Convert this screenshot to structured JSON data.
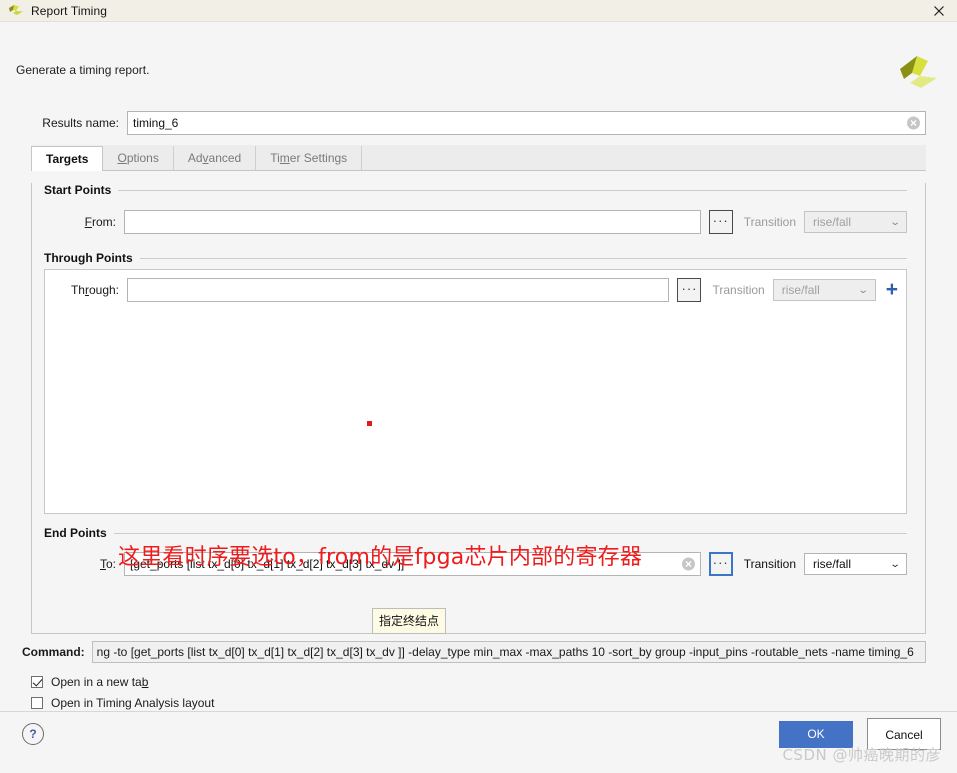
{
  "window": {
    "title": "Report Timing",
    "close_icon": "close-icon",
    "app_icon": "vivado-logo-icon"
  },
  "header": {
    "subtitle": "Generate a timing report.",
    "brand_icon": "xilinx-logo-icon"
  },
  "results": {
    "label": "Results name:",
    "value": "timing_6",
    "clear_icon": "✕"
  },
  "tabs": [
    {
      "label": "Targets",
      "mnemonic": "",
      "active": true
    },
    {
      "label": "Options",
      "mnemonic": "O",
      "active": false
    },
    {
      "label": "Advanced",
      "mnemonic": "v",
      "active": false
    },
    {
      "label": "Timer Settings",
      "mnemonic": "m",
      "active": false
    }
  ],
  "start_points": {
    "title": "Start Points",
    "from_label_pre": "F",
    "from_label_post": "rom:",
    "from_value": "",
    "ellipsis_label": "···",
    "transition_label": "Transition",
    "transition_value": "rise/fall",
    "chevron": "⌄",
    "enabled": false
  },
  "through_points": {
    "title": "Through Points",
    "through_label_pre": "Th",
    "through_label_mn": "r",
    "through_label_post": "ough:",
    "through_value": "",
    "ellipsis_label": "···",
    "transition_label": "Transition",
    "transition_value": "rise/fall",
    "chevron": "⌄",
    "add_label": "+",
    "enabled": false
  },
  "end_points": {
    "title": "End Points",
    "to_label_pre": "T",
    "to_label_post": "o:",
    "to_value": "[get_ports [list tx_d[0] tx_d[1] tx_d[2] tx_d[3] tx_dv ]]",
    "clear_icon": "✕",
    "ellipsis_label": "···",
    "transition_label": "Transition",
    "transition_value": "rise/fall",
    "chevron": "⌄",
    "enabled": true
  },
  "annotation": {
    "text": "这里看时序要选to，from的是fpga芯片内部的寄存器",
    "color": "#ee1c1c",
    "dot_color": "#e01b1b"
  },
  "tooltip": {
    "text": "指定终结点"
  },
  "command": {
    "label": "Command:",
    "value": "ng -to [get_ports [list tx_d[0] tx_d[1] tx_d[2] tx_d[3] tx_dv ]] -delay_type min_max -max_paths 10 -sort_by group -input_pins -routable_nets -name timing_6"
  },
  "checkboxes": [
    {
      "label_pre": "Open in a new ta",
      "label_mn": "b",
      "label_post": "",
      "checked": true
    },
    {
      "label_pre": "Open in Timing Analysis layout",
      "label_mn": "",
      "label_post": "",
      "checked": false
    }
  ],
  "footer": {
    "help_label": "?",
    "ok_label": "OK",
    "cancel_label": "Cancel",
    "watermark": "CSDN @帅癌晚期的彦"
  },
  "colors": {
    "accent": "#4472c4",
    "annotation_red": "#ee1c1c",
    "titlebar": "#f2efe6",
    "panel": "#f5f5f5",
    "plus_blue": "#2f5fb0"
  }
}
